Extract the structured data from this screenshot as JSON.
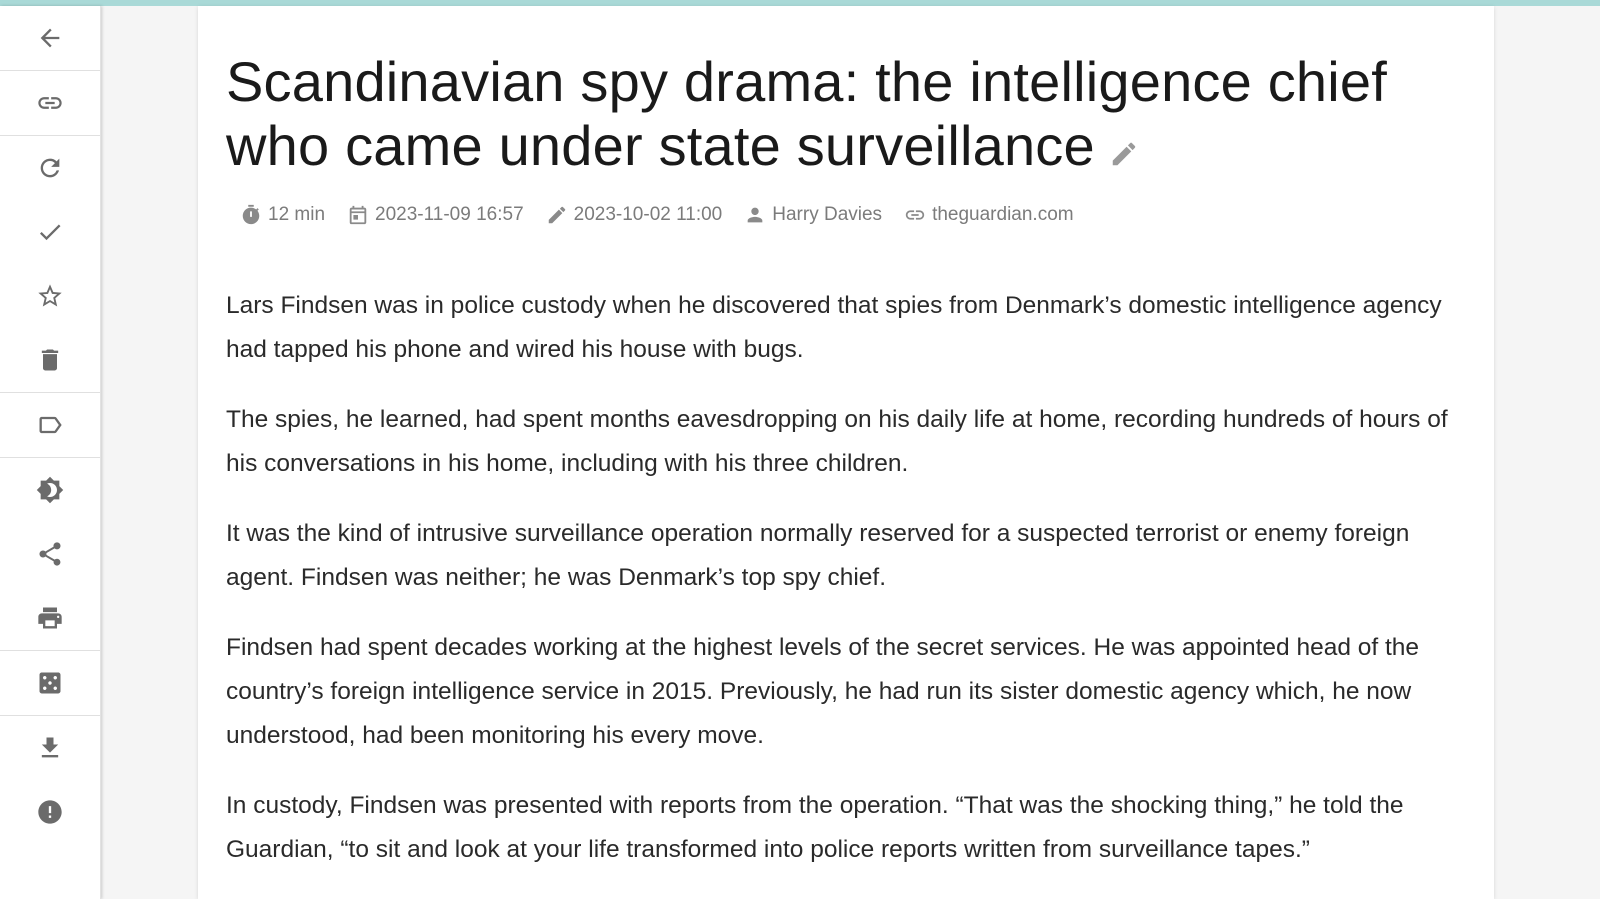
{
  "sidebar": {
    "items": [
      {
        "icon": "back-arrow-icon",
        "name": "back-button"
      },
      {
        "icon": "link-icon",
        "name": "open-original-button"
      },
      {
        "icon": "refresh-icon",
        "name": "refresh-button"
      },
      {
        "icon": "check-icon",
        "name": "mark-read-button"
      },
      {
        "icon": "star-icon",
        "name": "favorite-button"
      },
      {
        "icon": "trash-icon",
        "name": "delete-button"
      },
      {
        "icon": "label-icon",
        "name": "tags-button"
      },
      {
        "icon": "brightness-icon",
        "name": "theme-button"
      },
      {
        "icon": "share-icon",
        "name": "share-button"
      },
      {
        "icon": "print-icon",
        "name": "print-button"
      },
      {
        "icon": "dice-icon",
        "name": "random-button"
      },
      {
        "icon": "download-icon",
        "name": "download-button"
      },
      {
        "icon": "alert-icon",
        "name": "report-button"
      }
    ]
  },
  "article": {
    "title": "Scandinavian spy drama: the intelligence chief who came under state surveillance",
    "meta": {
      "reading_time": "12 min",
      "created": "2023-11-09 16:57",
      "published": "2023-10-02 11:00",
      "author": "Harry Davies",
      "domain": "theguardian.com"
    },
    "paragraphs": [
      "Lars Findsen was in police custody when he discovered that spies from Denmark’s domestic intelligence agency had tapped his phone and wired his house with bugs.",
      "The spies, he learned, had spent months eavesdropping on his daily life at home, recording hundreds of hours of his conversations in his home, including with his three children.",
      "It was the kind of intrusive surveillance operation normally reserved for a suspected terrorist or enemy foreign agent. Findsen was neither; he was Denmark’s top spy chief.",
      "Findsen had spent decades working at the highest levels of the secret services. He was appointed head of the country’s foreign intelligence service in 2015. Previously, he had run its sister domestic agency which, he now understood, had been monitoring his every move.",
      "In custody, Findsen was presented with reports from the operation. “That was the shocking thing,” he told the Guardian, “to sit and look at your life transformed into police reports written from surveillance tapes.”"
    ]
  },
  "colors": {
    "top_bar": "#a9d9d7",
    "icon_gray": "#6b6b6b",
    "meta_gray": "#7b7b7b"
  }
}
